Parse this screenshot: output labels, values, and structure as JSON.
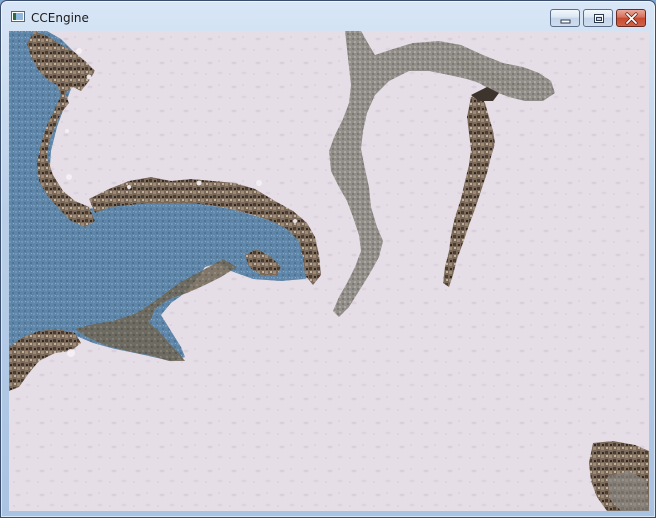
{
  "window": {
    "title": "CCEngine",
    "icon": "app-icon",
    "controls": [
      "minimize-icon",
      "maximize-icon",
      "close-icon"
    ]
  },
  "map": {
    "terrain": [
      "snow-ground",
      "icy-water",
      "rocky-cliffs",
      "frozen-river",
      "ridge",
      "dirt-patch"
    ]
  }
}
